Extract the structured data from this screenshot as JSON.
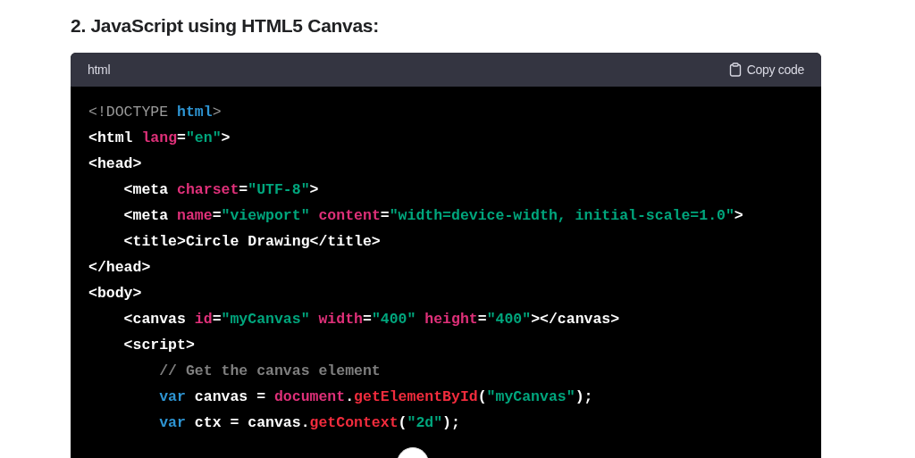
{
  "heading": "2. JavaScript using HTML5 Canvas:",
  "code_block": {
    "language": "html",
    "copy_button": "Copy code",
    "lines": [
      [
        {
          "kind": "doctype",
          "text": "<!DOCTYPE "
        },
        {
          "kind": "name",
          "text": "html"
        },
        {
          "kind": "doctype",
          "text": ">"
        }
      ],
      [
        {
          "kind": "tag",
          "text": "<html "
        },
        {
          "kind": "attr",
          "text": "lang"
        },
        {
          "kind": "tag",
          "text": "="
        },
        {
          "kind": "string",
          "text": "\"en\""
        },
        {
          "kind": "tag",
          "text": ">"
        }
      ],
      [
        {
          "kind": "tag",
          "text": "<head>"
        }
      ],
      [
        {
          "kind": "tag",
          "text": "    <meta "
        },
        {
          "kind": "attr",
          "text": "charset"
        },
        {
          "kind": "tag",
          "text": "="
        },
        {
          "kind": "string",
          "text": "\"UTF-8\""
        },
        {
          "kind": "tag",
          "text": ">"
        }
      ],
      [
        {
          "kind": "tag",
          "text": "    <meta "
        },
        {
          "kind": "attr",
          "text": "name"
        },
        {
          "kind": "tag",
          "text": "="
        },
        {
          "kind": "string",
          "text": "\"viewport\" "
        },
        {
          "kind": "attr",
          "text": "content"
        },
        {
          "kind": "tag",
          "text": "="
        },
        {
          "kind": "string",
          "text": "\"width=device-width, initial-scale=1.0\""
        },
        {
          "kind": "tag",
          "text": ">"
        }
      ],
      [
        {
          "kind": "tag",
          "text": "    <title>Circle Drawing</title>"
        }
      ],
      [
        {
          "kind": "tag",
          "text": "</head>"
        }
      ],
      [
        {
          "kind": "tag",
          "text": "<body>"
        }
      ],
      [
        {
          "kind": "tag",
          "text": "    <canvas "
        },
        {
          "kind": "attr",
          "text": "id"
        },
        {
          "kind": "tag",
          "text": "="
        },
        {
          "kind": "string",
          "text": "\"myCanvas\" "
        },
        {
          "kind": "attr",
          "text": "width"
        },
        {
          "kind": "tag",
          "text": "="
        },
        {
          "kind": "string",
          "text": "\"400\" "
        },
        {
          "kind": "attr",
          "text": "height"
        },
        {
          "kind": "tag",
          "text": "="
        },
        {
          "kind": "string",
          "text": "\"400\""
        },
        {
          "kind": "tag",
          "text": "></canvas>"
        }
      ],
      [
        {
          "kind": "tag",
          "text": "    <script>"
        }
      ],
      [
        {
          "kind": "comment",
          "text": "        // Get the canvas element"
        }
      ],
      [
        {
          "kind": "keyword",
          "text": "        var"
        },
        {
          "kind": "tag",
          "text": " canvas = "
        },
        {
          "kind": "attr",
          "text": "document"
        },
        {
          "kind": "tag",
          "text": "."
        },
        {
          "kind": "func",
          "text": "getElementById"
        },
        {
          "kind": "tag",
          "text": "("
        },
        {
          "kind": "string",
          "text": "\"myCanvas\""
        },
        {
          "kind": "tag",
          "text": ");"
        }
      ],
      [
        {
          "kind": "keyword",
          "text": "        var"
        },
        {
          "kind": "tag",
          "text": " ctx = canvas."
        },
        {
          "kind": "func",
          "text": "getContext"
        },
        {
          "kind": "tag",
          "text": "("
        },
        {
          "kind": "string",
          "text": "\"2d\""
        },
        {
          "kind": "tag",
          "text": ");"
        }
      ]
    ]
  }
}
